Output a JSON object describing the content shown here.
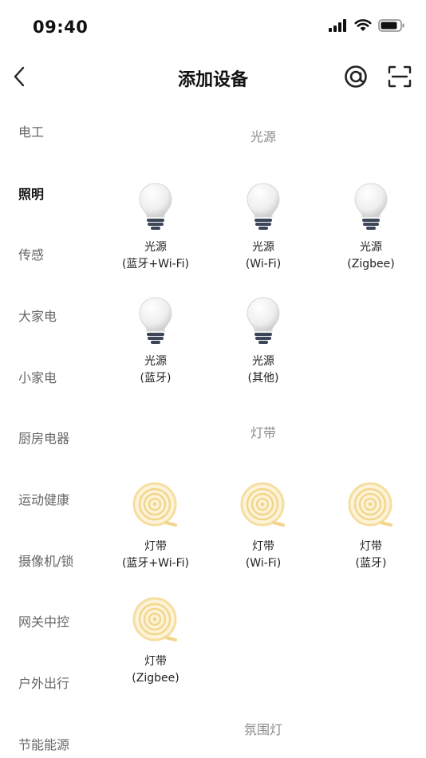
{
  "status_bar": {
    "time": "09:40"
  },
  "nav": {
    "title": "添加设备"
  },
  "sidebar": {
    "items": [
      {
        "label": "电工",
        "active": false
      },
      {
        "label": "照明",
        "active": true
      },
      {
        "label": "传感",
        "active": false
      },
      {
        "label": "大家电",
        "active": false
      },
      {
        "label": "小家电",
        "active": false
      },
      {
        "label": "厨房电器",
        "active": false
      },
      {
        "label": "运动健康",
        "active": false
      },
      {
        "label": "摄像机/锁",
        "active": false
      },
      {
        "label": "网关中控",
        "active": false
      },
      {
        "label": "户外出行",
        "active": false
      },
      {
        "label": "节能能源",
        "active": false
      }
    ]
  },
  "sections": [
    {
      "title": "光源",
      "devices": [
        {
          "name": "光源",
          "sub": "(蓝牙+Wi-Fi)",
          "icon": "bulb-icon"
        },
        {
          "name": "光源",
          "sub": "(Wi-Fi)",
          "icon": "bulb-icon"
        },
        {
          "name": "光源",
          "sub": "(Zigbee)",
          "icon": "bulb-icon"
        },
        {
          "name": "光源",
          "sub": "(蓝牙)",
          "icon": "bulb-icon"
        },
        {
          "name": "光源",
          "sub": "(其他)",
          "icon": "bulb-icon"
        }
      ]
    },
    {
      "title": "灯带",
      "devices": [
        {
          "name": "灯带",
          "sub": "(蓝牙+Wi-Fi)",
          "icon": "light-strip-icon"
        },
        {
          "name": "灯带",
          "sub": "(Wi-Fi)",
          "icon": "light-strip-icon"
        },
        {
          "name": "灯带",
          "sub": "(蓝牙)",
          "icon": "light-strip-icon"
        },
        {
          "name": "灯带",
          "sub": "(Zigbee)",
          "icon": "light-strip-icon"
        }
      ]
    },
    {
      "title": "氛围灯",
      "devices": []
    }
  ],
  "colors": {
    "active_text": "#111111",
    "inactive_text": "#666666",
    "section_title": "#8a8a8a",
    "strip_color": "#f5d98a"
  }
}
